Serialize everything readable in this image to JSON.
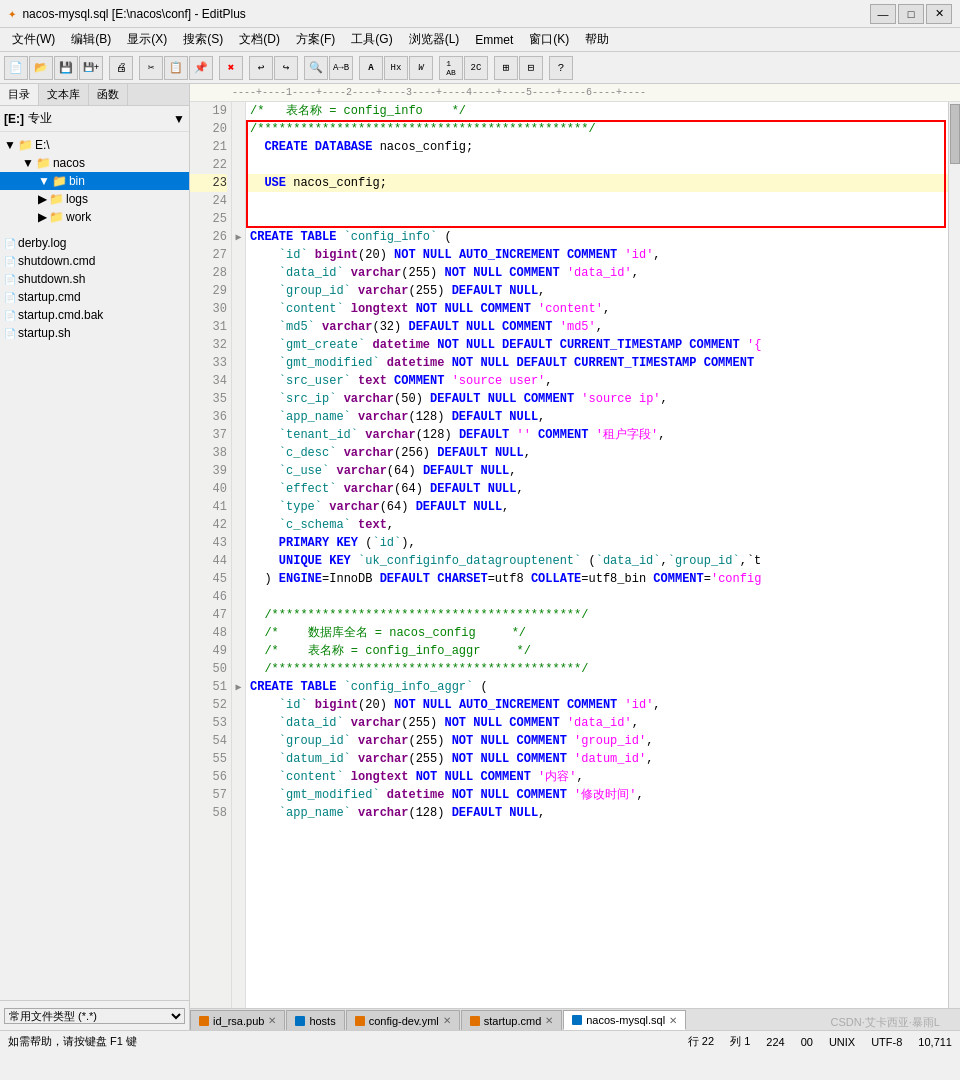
{
  "titlebar": {
    "title": "nacos-mysql.sql [E:\\nacos\\conf] - EditPlus",
    "icon": "✦",
    "min_label": "—",
    "max_label": "□",
    "close_label": "✕"
  },
  "menubar": {
    "items": [
      "文件(W)",
      "编辑(B)",
      "显示(X)",
      "搜索(S)",
      "文档(D)",
      "方案(F)",
      "工具(G)",
      "浏览器(L)",
      "Emmet",
      "窗口(K)",
      "帮助"
    ]
  },
  "sidebar": {
    "tabs": [
      "目录",
      "文本库",
      "函数"
    ],
    "tree_label": "[E:] 专业",
    "items": [
      {
        "label": "E:\\",
        "indent": 0,
        "type": "folder",
        "expanded": true
      },
      {
        "label": "nacos",
        "indent": 1,
        "type": "folder",
        "expanded": true
      },
      {
        "label": "bin",
        "indent": 2,
        "type": "folder",
        "expanded": true,
        "selected": true
      },
      {
        "label": "logs",
        "indent": 2,
        "type": "folder",
        "expanded": false
      },
      {
        "label": "work",
        "indent": 2,
        "type": "folder",
        "expanded": false
      },
      {
        "label": "",
        "indent": 0,
        "type": "sep"
      },
      {
        "label": "derby.log",
        "indent": 0,
        "type": "file"
      },
      {
        "label": "shutdown.cmd",
        "indent": 0,
        "type": "file"
      },
      {
        "label": "shutdown.sh",
        "indent": 0,
        "type": "file"
      },
      {
        "label": "startup.cmd",
        "indent": 0,
        "type": "file"
      },
      {
        "label": "startup.cmd.bak",
        "indent": 0,
        "type": "file"
      },
      {
        "label": "startup.sh",
        "indent": 0,
        "type": "file"
      }
    ],
    "dropdown": "常用文件类型 (*.*)"
  },
  "ruler": "----+----1----+----2----+----3----+----4----+----5----+----6----+----",
  "code": {
    "lines": [
      {
        "num": 19,
        "content": "/*   表名称 = config_info   */",
        "type": "comment"
      },
      {
        "num": 20,
        "content": "/**********************************************/",
        "type": "comment_border",
        "selected_start": true
      },
      {
        "num": 21,
        "content": "  CREATE DATABASE nacos_config;",
        "type": "code_create_db",
        "selected": true
      },
      {
        "num": 22,
        "content": "",
        "type": "empty",
        "selected": true
      },
      {
        "num": 23,
        "content": "  USE nacos_config;",
        "type": "code_use",
        "selected": true
      },
      {
        "num": 24,
        "content": "",
        "type": "empty",
        "selected": true
      },
      {
        "num": 25,
        "content": "",
        "type": "empty",
        "selected_end": true
      },
      {
        "num": 26,
        "content": "CREATE TABLE `config_info` (",
        "type": "code_create_table",
        "collapsible": true
      },
      {
        "num": 27,
        "content": "    `id` bigint(20) NOT NULL AUTO_INCREMENT COMMENT 'id',",
        "type": "code"
      },
      {
        "num": 28,
        "content": "    `data_id` varchar(255) NOT NULL COMMENT 'data_id',",
        "type": "code"
      },
      {
        "num": 29,
        "content": "    `group_id` varchar(255) DEFAULT NULL,",
        "type": "code"
      },
      {
        "num": 30,
        "content": "    `content` longtext NOT NULL COMMENT 'content',",
        "type": "code"
      },
      {
        "num": 31,
        "content": "    `md5` varchar(32) DEFAULT NULL COMMENT 'md5',",
        "type": "code"
      },
      {
        "num": 32,
        "content": "    `gmt_create` datetime NOT NULL DEFAULT CURRENT_TIMESTAMP COMMENT '{",
        "type": "code_long"
      },
      {
        "num": 33,
        "content": "    `gmt_modified` datetime NOT NULL DEFAULT CURRENT_TIMESTAMP COMMENT",
        "type": "code_long"
      },
      {
        "num": 34,
        "content": "    `src_user` text COMMENT 'source user',",
        "type": "code"
      },
      {
        "num": 35,
        "content": "    `src_ip` varchar(50) DEFAULT NULL COMMENT 'source ip',",
        "type": "code"
      },
      {
        "num": 36,
        "content": "    `app_name` varchar(128) DEFAULT NULL,",
        "type": "code"
      },
      {
        "num": 37,
        "content": "    `tenant_id` varchar(128) DEFAULT '' COMMENT '租户字段',",
        "type": "code"
      },
      {
        "num": 38,
        "content": "    `c_desc` varchar(256) DEFAULT NULL,",
        "type": "code"
      },
      {
        "num": 39,
        "content": "    `c_use` varchar(64) DEFAULT NULL,",
        "type": "code"
      },
      {
        "num": 40,
        "content": "    `effect` varchar(64) DEFAULT NULL,",
        "type": "code"
      },
      {
        "num": 41,
        "content": "    `type` varchar(64) DEFAULT NULL,",
        "type": "code"
      },
      {
        "num": 42,
        "content": "    `c_schema` text,",
        "type": "code"
      },
      {
        "num": 43,
        "content": "    PRIMARY KEY (`id`),",
        "type": "code"
      },
      {
        "num": 44,
        "content": "    UNIQUE KEY `uk_configinfo_datagrouptenent` (`data_id`,`group_id`,`t",
        "type": "code_long"
      },
      {
        "num": 45,
        "content": "  ) ENGINE=InnoDB DEFAULT CHARSET=utf8 COLLATE=utf8_bin COMMENT='config",
        "type": "code_long"
      },
      {
        "num": 46,
        "content": "",
        "type": "empty"
      },
      {
        "num": 47,
        "content": "  /*******************************************/",
        "type": "comment"
      },
      {
        "num": 48,
        "content": "  /*    数据库全名 = nacos_config     */",
        "type": "comment"
      },
      {
        "num": 49,
        "content": "  /*    表名称 = config_info_aggr     */",
        "type": "comment"
      },
      {
        "num": 50,
        "content": "  /*******************************************/",
        "type": "comment"
      },
      {
        "num": 51,
        "content": "CREATE TABLE `config_info_aggr` (",
        "type": "code_create_table2",
        "collapsible": true
      },
      {
        "num": 52,
        "content": "    `id` bigint(20) NOT NULL AUTO_INCREMENT COMMENT 'id',",
        "type": "code"
      },
      {
        "num": 53,
        "content": "    `data_id` varchar(255) NOT NULL COMMENT 'data_id',",
        "type": "code"
      },
      {
        "num": 54,
        "content": "    `group_id` varchar(255) NOT NULL COMMENT 'group_id',",
        "type": "code"
      },
      {
        "num": 55,
        "content": "    `datum_id` varchar(255) NOT NULL COMMENT 'datum_id',",
        "type": "code"
      },
      {
        "num": 56,
        "content": "    `content` longtext NOT NULL COMMENT '内容',",
        "type": "code"
      },
      {
        "num": 57,
        "content": "    `gmt_modified` datetime NOT NULL COMMENT '修改时间',",
        "type": "code"
      },
      {
        "num": 58,
        "content": "    `app_name` varchar(128) DEFAULT NULL,",
        "type": "code"
      }
    ]
  },
  "tabs": [
    {
      "label": "id_rsa.pub",
      "icon": "orange",
      "closable": true,
      "active": false
    },
    {
      "label": "hosts",
      "icon": "blue",
      "closable": false,
      "active": false
    },
    {
      "label": "config-dev.yml",
      "icon": "orange",
      "closable": true,
      "active": false
    },
    {
      "label": "startup.cmd",
      "icon": "orange",
      "closable": true,
      "active": false
    },
    {
      "label": "nacos-mysql.sql",
      "icon": "blue",
      "closable": true,
      "active": true
    }
  ],
  "statusbar": {
    "help": "如需帮助，请按键盘 F1 键",
    "row": "行 22",
    "col": "列 1",
    "chars": "224",
    "code_page": "00",
    "os": "UNIX",
    "encoding": "UTF-8",
    "pos": "10,711"
  },
  "watermark": "CSDN·艾卡西亚·暴雨L"
}
